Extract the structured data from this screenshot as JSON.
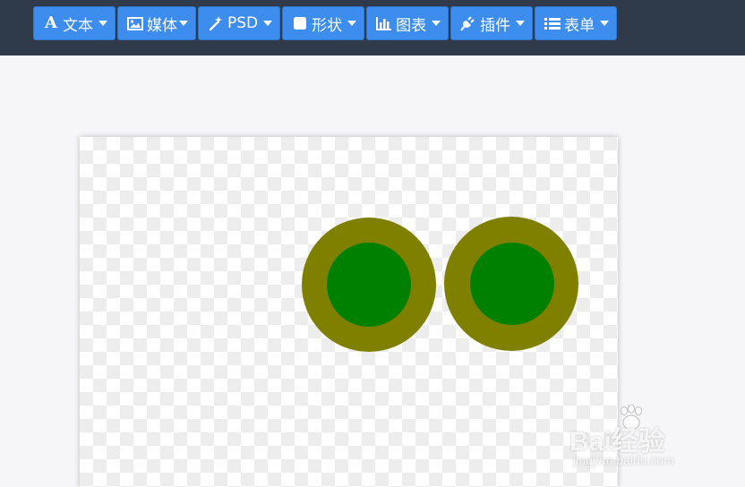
{
  "toolbar": {
    "buttons": [
      {
        "label": "文本",
        "icon": "text-icon"
      },
      {
        "label": "媒体",
        "icon": "image-icon"
      },
      {
        "label": "PSD",
        "icon": "magic-wand-icon"
      },
      {
        "label": "形状",
        "icon": "square-icon"
      },
      {
        "label": "图表",
        "icon": "bar-chart-icon"
      },
      {
        "label": "插件",
        "icon": "plug-icon"
      },
      {
        "label": "表单",
        "icon": "list-icon"
      }
    ]
  },
  "canvas": {
    "shapes": [
      {
        "type": "ring",
        "outer_color": "#808000",
        "inner_color": "#008000"
      },
      {
        "type": "ring",
        "outer_color": "#808000",
        "inner_color": "#008000"
      }
    ]
  },
  "colors": {
    "toolbar_bg": "#2f3a4a",
    "button_bg": "#3c8dee",
    "workspace_bg": "#f6f5f8"
  },
  "watermark": {
    "main": "Bai经验",
    "sub": "jingyan.baidu.com"
  }
}
